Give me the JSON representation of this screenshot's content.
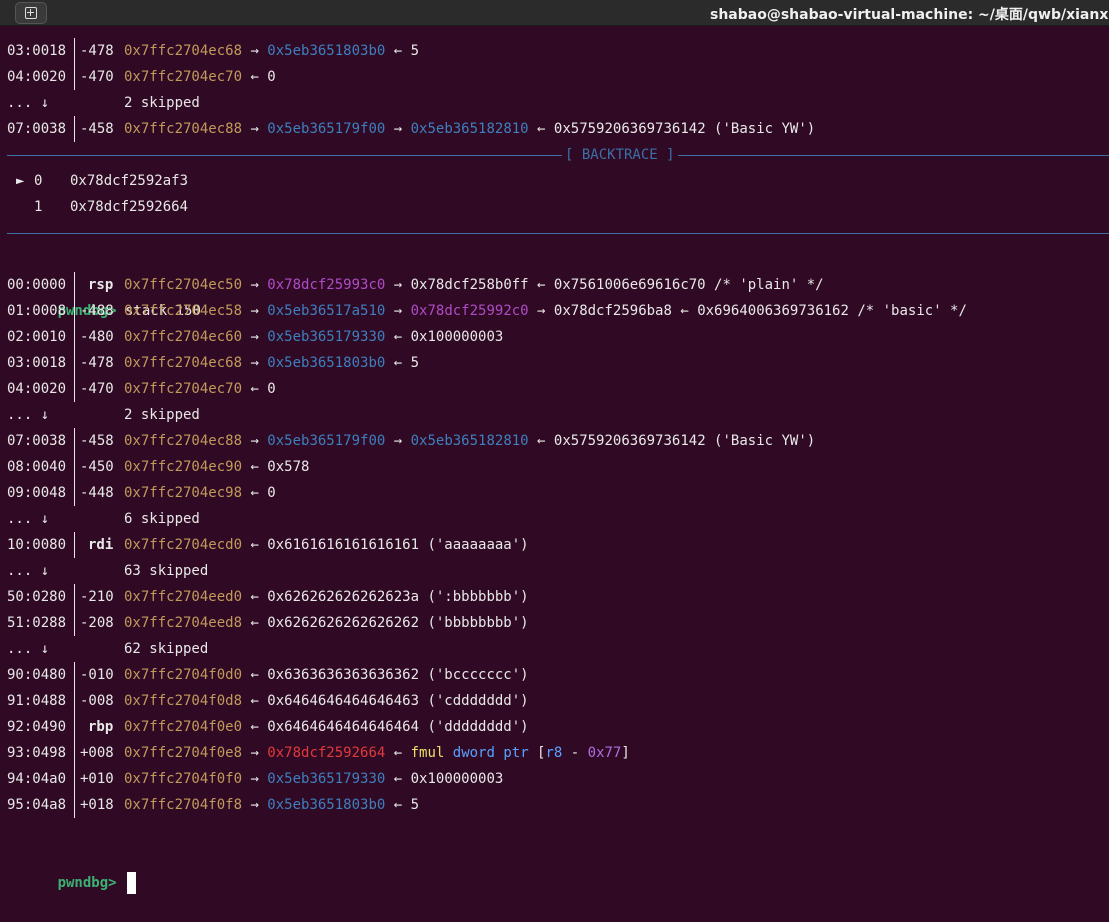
{
  "window": {
    "title": "shabao@shabao-virtual-machine: ~/桌面/qwb/xianxia/lig"
  },
  "colors": {
    "background": "#300a24",
    "stack_addr": "#c19a5b",
    "heap_addr": "#3f7fbf",
    "lib_addr": "#b04bc7",
    "code_addr": "#e03a3a",
    "prompt": "#3bb273",
    "separator": "#3b6fa8"
  },
  "top_stack": [
    {
      "idx": "03:0018",
      "off": "-478",
      "addr": "0x7ffc2704ec68",
      "rest": [
        {
          "t": "→ ",
          "c": "plain"
        },
        {
          "t": "0x5eb3651803b0",
          "c": "heap"
        },
        {
          "t": " ← 5",
          "c": "plain"
        }
      ]
    },
    {
      "idx": "04:0020",
      "off": "-470",
      "addr": "0x7ffc2704ec70",
      "rest": [
        {
          "t": "← 0",
          "c": "plain"
        }
      ]
    },
    {
      "skip": true,
      "dots": "... ↓",
      "text": "2 skipped"
    },
    {
      "idx": "07:0038",
      "off": "-458",
      "addr": "0x7ffc2704ec88",
      "rest": [
        {
          "t": "→ ",
          "c": "plain"
        },
        {
          "t": "0x5eb365179f00",
          "c": "heap"
        },
        {
          "t": " → ",
          "c": "plain"
        },
        {
          "t": "0x5eb365182810",
          "c": "heap"
        },
        {
          "t": " ← 0x5759206369736142 ('Basic YW')",
          "c": "plain"
        }
      ]
    }
  ],
  "backtrace": {
    "label": "[ BACKTRACE ]",
    "frames": [
      {
        "marker": "►",
        "num": "0",
        "addr": "0x78dcf2592af3"
      },
      {
        "marker": "",
        "num": "1",
        "addr": "0x78dcf2592664"
      }
    ]
  },
  "command": {
    "prompt": "pwndbg>",
    "text": " stack 150"
  },
  "stack": [
    {
      "idx": "00:0000",
      "off": "rsp",
      "reg": true,
      "addr": "0x7ffc2704ec50",
      "rest": [
        {
          "t": "→ ",
          "c": "plain"
        },
        {
          "t": "0x78dcf25993c0",
          "c": "lib"
        },
        {
          "t": " → 0x78dcf258b0ff ← 0x7561006e69616c70 /* 'plain' */",
          "c": "plain"
        }
      ]
    },
    {
      "idx": "01:0008",
      "off": "-488",
      "addr": "0x7ffc2704ec58",
      "rest": [
        {
          "t": "→ ",
          "c": "plain"
        },
        {
          "t": "0x5eb36517a510",
          "c": "heap"
        },
        {
          "t": " → ",
          "c": "plain"
        },
        {
          "t": "0x78dcf25992c0",
          "c": "lib"
        },
        {
          "t": " → 0x78dcf2596ba8 ← 0x6964006369736162 /* 'basic' */",
          "c": "plain"
        }
      ]
    },
    {
      "idx": "02:0010",
      "off": "-480",
      "addr": "0x7ffc2704ec60",
      "rest": [
        {
          "t": "→ ",
          "c": "plain"
        },
        {
          "t": "0x5eb365179330",
          "c": "heap"
        },
        {
          "t": " ← 0x100000003",
          "c": "plain"
        }
      ]
    },
    {
      "idx": "03:0018",
      "off": "-478",
      "addr": "0x7ffc2704ec68",
      "rest": [
        {
          "t": "→ ",
          "c": "plain"
        },
        {
          "t": "0x5eb3651803b0",
          "c": "heap"
        },
        {
          "t": " ← 5",
          "c": "plain"
        }
      ]
    },
    {
      "idx": "04:0020",
      "off": "-470",
      "addr": "0x7ffc2704ec70",
      "rest": [
        {
          "t": "← 0",
          "c": "plain"
        }
      ]
    },
    {
      "skip": true,
      "dots": "... ↓",
      "text": "2 skipped"
    },
    {
      "idx": "07:0038",
      "off": "-458",
      "addr": "0x7ffc2704ec88",
      "rest": [
        {
          "t": "→ ",
          "c": "plain"
        },
        {
          "t": "0x5eb365179f00",
          "c": "heap"
        },
        {
          "t": " → ",
          "c": "plain"
        },
        {
          "t": "0x5eb365182810",
          "c": "heap"
        },
        {
          "t": " ← 0x5759206369736142 ('Basic YW')",
          "c": "plain"
        }
      ]
    },
    {
      "idx": "08:0040",
      "off": "-450",
      "addr": "0x7ffc2704ec90",
      "rest": [
        {
          "t": "← 0x578",
          "c": "plain"
        }
      ]
    },
    {
      "idx": "09:0048",
      "off": "-448",
      "addr": "0x7ffc2704ec98",
      "rest": [
        {
          "t": "← 0",
          "c": "plain"
        }
      ]
    },
    {
      "skip": true,
      "dots": "... ↓",
      "text": "6 skipped"
    },
    {
      "idx": "10:0080",
      "off": "rdi",
      "reg": true,
      "addr": "0x7ffc2704ecd0",
      "rest": [
        {
          "t": "← 0x6161616161616161 ('aaaaaaaa')",
          "c": "plain"
        }
      ]
    },
    {
      "skip": true,
      "dots": "... ↓",
      "text": "63 skipped"
    },
    {
      "idx": "50:0280",
      "off": "-210",
      "addr": "0x7ffc2704eed0",
      "rest": [
        {
          "t": "← 0x626262626262623a (':bbbbbbb')",
          "c": "plain"
        }
      ]
    },
    {
      "idx": "51:0288",
      "off": "-208",
      "addr": "0x7ffc2704eed8",
      "rest": [
        {
          "t": "← 0x6262626262626262 ('bbbbbbbb')",
          "c": "plain"
        }
      ]
    },
    {
      "skip": true,
      "dots": "... ↓",
      "text": "62 skipped"
    },
    {
      "idx": "90:0480",
      "off": "-010",
      "addr": "0x7ffc2704f0d0",
      "rest": [
        {
          "t": "← 0x6363636363636362 ('bccccccc')",
          "c": "plain"
        }
      ]
    },
    {
      "idx": "91:0488",
      "off": "-008",
      "addr": "0x7ffc2704f0d8",
      "rest": [
        {
          "t": "← 0x6464646464646463 ('cddddddd')",
          "c": "plain"
        }
      ]
    },
    {
      "idx": "92:0490",
      "off": "rbp",
      "reg": true,
      "addr": "0x7ffc2704f0e0",
      "rest": [
        {
          "t": "← 0x6464646464646464 ('dddddddd')",
          "c": "plain"
        }
      ]
    },
    {
      "idx": "93:0498",
      "off": "+008",
      "addr": "0x7ffc2704f0e8",
      "rest": [
        {
          "t": "→ ",
          "c": "plain"
        },
        {
          "t": "0x78dcf2592664",
          "c": "code"
        },
        {
          "t": " ← ",
          "c": "plain"
        },
        {
          "t": "fmul",
          "c": "insn"
        },
        {
          "t": " ",
          "c": "plain"
        },
        {
          "t": "dword ptr",
          "c": "opnd"
        },
        {
          "t": " [",
          "c": "plain"
        },
        {
          "t": "r8",
          "c": "opnd"
        },
        {
          "t": " - ",
          "c": "plain"
        },
        {
          "t": "0x77",
          "c": "num"
        },
        {
          "t": "]",
          "c": "plain"
        }
      ]
    },
    {
      "idx": "94:04a0",
      "off": "+010",
      "addr": "0x7ffc2704f0f0",
      "rest": [
        {
          "t": "→ ",
          "c": "plain"
        },
        {
          "t": "0x5eb365179330",
          "c": "heap"
        },
        {
          "t": " ← 0x100000003",
          "c": "plain"
        }
      ]
    },
    {
      "idx": "95:04a8",
      "off": "+018",
      "addr": "0x7ffc2704f0f8",
      "rest": [
        {
          "t": "→ ",
          "c": "plain"
        },
        {
          "t": "0x5eb3651803b0",
          "c": "heap"
        },
        {
          "t": " ← 5",
          "c": "plain"
        }
      ]
    }
  ],
  "final_prompt": "pwndbg>"
}
